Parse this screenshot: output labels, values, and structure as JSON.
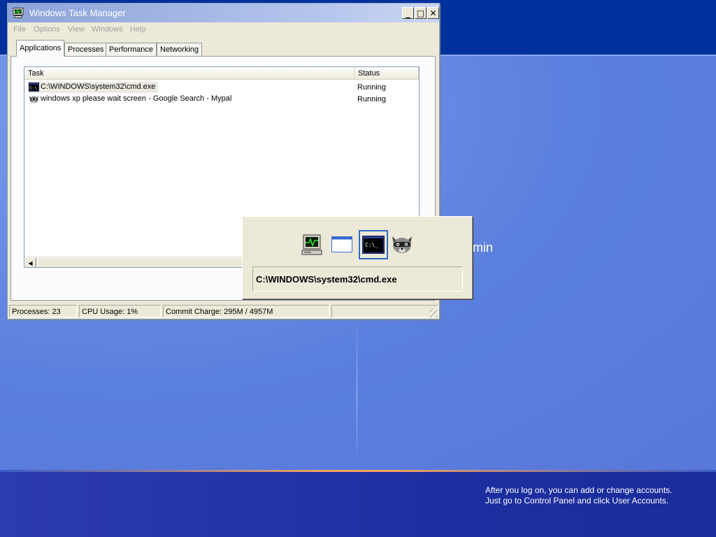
{
  "desktop": {
    "partial_user_name": "min",
    "bottom_hint_line1": "After you log on, you can add or change accounts.",
    "bottom_hint_line2": "Just go to Control Panel and click User Accounts."
  },
  "window": {
    "title": "Windows Task Manager",
    "minimize_glyph": "_",
    "maximize_glyph": "□",
    "close_glyph": "✕",
    "menu": [
      "File",
      "Options",
      "View",
      "Windows",
      "Help"
    ]
  },
  "tabs": [
    {
      "label": "Applications",
      "active": true
    },
    {
      "label": "Processes",
      "active": false
    },
    {
      "label": "Performance",
      "active": false
    },
    {
      "label": "Networking",
      "active": false
    }
  ],
  "task_list": {
    "columns": [
      "Task",
      "Status"
    ],
    "rows": [
      {
        "task": "C:\\WINDOWS\\system32\\cmd.exe",
        "status": "Running",
        "icon": "cmd-icon",
        "selected": true
      },
      {
        "task": "windows xp please wait screen - Google Search - Mypal",
        "status": "Running",
        "icon": "mypal-raccoon-icon",
        "selected": false
      }
    ]
  },
  "statusbar": {
    "processes": "Processes: 23",
    "cpu": "CPU Usage: 1%",
    "commit": "Commit Charge: 295M / 4957M"
  },
  "alt_tab": {
    "icons": [
      "task-manager-icon",
      "blank-window-icon",
      "cmd-icon",
      "mypal-raccoon-icon"
    ],
    "selected_index": 2,
    "caption": "C:\\WINDOWS\\system32\\cmd.exe",
    "cmd_icon_text": "C:\\_"
  },
  "colors": {
    "selection_border": "#316ac5",
    "titlebar_inactive": "#8da3d9",
    "desktop_blue": "#5a7edc"
  }
}
